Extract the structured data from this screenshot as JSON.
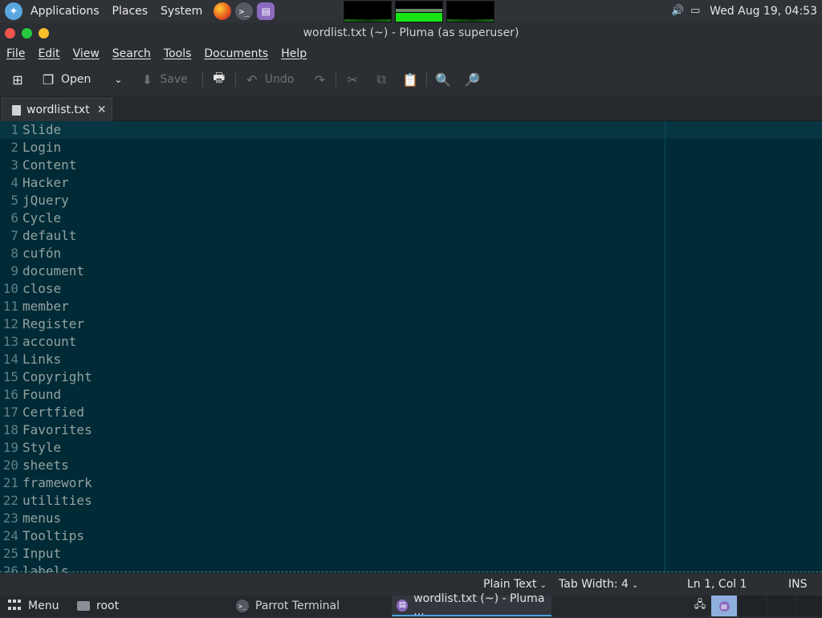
{
  "topbar": {
    "applications": "Applications",
    "places": "Places",
    "system": "System",
    "clock": "Wed Aug 19, 04:53"
  },
  "window": {
    "title": "wordlist.txt (~) - Pluma (as superuser)"
  },
  "menubar": [
    "File",
    "Edit",
    "View",
    "Search",
    "Tools",
    "Documents",
    "Help"
  ],
  "toolbar": {
    "open": "Open",
    "save": "Save",
    "undo": "Undo"
  },
  "tab": {
    "name": "wordlist.txt"
  },
  "editor": {
    "lines": [
      "Slide",
      "Login",
      "Content",
      "Hacker",
      "jQuery",
      "Cycle",
      "default",
      "cufón",
      "document",
      "close",
      "member",
      "Register",
      "account",
      "Links",
      "Copyright",
      "Found",
      "Certfied",
      "Favorites",
      "Style",
      "sheets",
      "framework",
      "utilities",
      "menus",
      "Tooltips",
      "Input",
      "labels"
    ]
  },
  "status": {
    "syntax": "Plain Text",
    "tab_width": "Tab Width:  4",
    "position": "Ln 1, Col 1",
    "mode": "INS"
  },
  "taskbar": {
    "menu": "Menu",
    "root": "root",
    "terminal": "Parrot Terminal",
    "pluma": "wordlist.txt (~) - Pluma ..."
  },
  "colors": {
    "editor_bg": "#002b36",
    "current_line": "#073642",
    "text": "#93a1a1"
  }
}
